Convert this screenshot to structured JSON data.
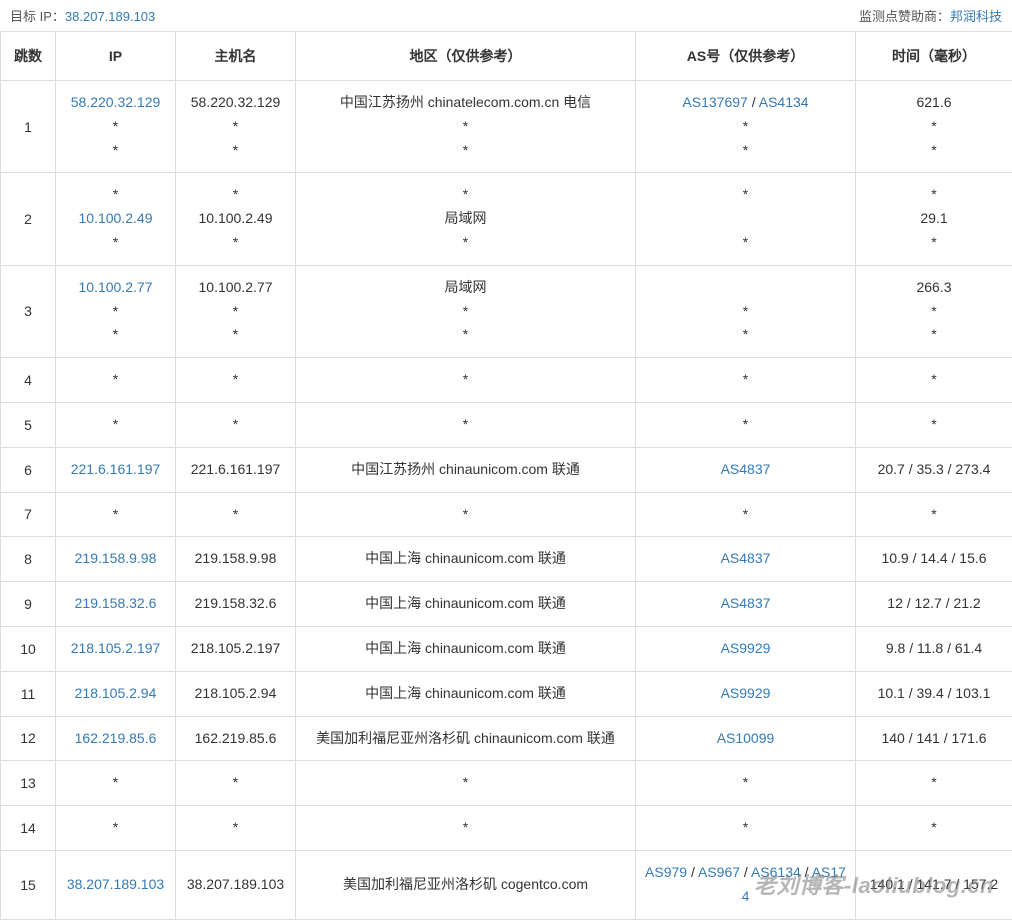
{
  "header": {
    "target_label": "目标 IP：",
    "target_ip": "38.207.189.103",
    "sponsor_label": "监测点赞助商：",
    "sponsor_name": "邦润科技"
  },
  "columns": {
    "hop": "跳数",
    "ip": "IP",
    "host": "主机名",
    "region": "地区（仅供参考）",
    "as": "AS号（仅供参考）",
    "time": "时间（毫秒）"
  },
  "rows": [
    {
      "hop": "1",
      "ip_lines": [
        {
          "text": "58.220.32.129",
          "link": true
        },
        {
          "text": "*"
        },
        {
          "text": "*"
        }
      ],
      "host_lines": [
        "58.220.32.129",
        "*",
        "*"
      ],
      "region_lines": [
        "中国江苏扬州 chinatelecom.com.cn 电信",
        "*",
        "*"
      ],
      "as_lines": [
        [
          {
            "text": "AS137697",
            "link": true
          },
          {
            "text": " / "
          },
          {
            "text": "AS4134",
            "link": true
          }
        ],
        [
          "*"
        ],
        [
          "*"
        ]
      ],
      "time_lines": [
        "621.6",
        "*",
        "*"
      ]
    },
    {
      "hop": "2",
      "ip_lines": [
        {
          "text": "*"
        },
        {
          "text": "10.100.2.49",
          "link": true
        },
        {
          "text": "*"
        }
      ],
      "host_lines": [
        "*",
        "10.100.2.49",
        "*"
      ],
      "region_lines": [
        "*",
        "局域网",
        "*"
      ],
      "as_lines": [
        [
          "*"
        ],
        [
          ""
        ],
        [
          "*"
        ]
      ],
      "time_lines": [
        "*",
        "29.1",
        "*"
      ]
    },
    {
      "hop": "3",
      "ip_lines": [
        {
          "text": "10.100.2.77",
          "link": true
        },
        {
          "text": "*"
        },
        {
          "text": "*"
        }
      ],
      "host_lines": [
        "10.100.2.77",
        "*",
        "*"
      ],
      "region_lines": [
        "局域网",
        "*",
        "*"
      ],
      "as_lines": [
        [
          ""
        ],
        [
          "*"
        ],
        [
          "*"
        ]
      ],
      "time_lines": [
        "266.3",
        "*",
        "*"
      ]
    },
    {
      "hop": "4",
      "ip_lines": [
        {
          "text": "*"
        }
      ],
      "host_lines": [
        "*"
      ],
      "region_lines": [
        "*"
      ],
      "as_lines": [
        [
          "*"
        ]
      ],
      "time_lines": [
        "*"
      ]
    },
    {
      "hop": "5",
      "ip_lines": [
        {
          "text": "*"
        }
      ],
      "host_lines": [
        "*"
      ],
      "region_lines": [
        "*"
      ],
      "as_lines": [
        [
          "*"
        ]
      ],
      "time_lines": [
        "*"
      ]
    },
    {
      "hop": "6",
      "ip_lines": [
        {
          "text": "221.6.161.197",
          "link": true
        }
      ],
      "host_lines": [
        "221.6.161.197"
      ],
      "region_lines": [
        "中国江苏扬州 chinaunicom.com 联通"
      ],
      "as_lines": [
        [
          {
            "text": "AS4837",
            "link": true
          }
        ]
      ],
      "time_lines": [
        "20.7 / 35.3 / 273.4"
      ]
    },
    {
      "hop": "7",
      "ip_lines": [
        {
          "text": "*"
        }
      ],
      "host_lines": [
        "*"
      ],
      "region_lines": [
        "*"
      ],
      "as_lines": [
        [
          "*"
        ]
      ],
      "time_lines": [
        "*"
      ]
    },
    {
      "hop": "8",
      "ip_lines": [
        {
          "text": "219.158.9.98",
          "link": true
        }
      ],
      "host_lines": [
        "219.158.9.98"
      ],
      "region_lines": [
        "中国上海 chinaunicom.com 联通"
      ],
      "as_lines": [
        [
          {
            "text": "AS4837",
            "link": true
          }
        ]
      ],
      "time_lines": [
        "10.9 / 14.4 / 15.6"
      ]
    },
    {
      "hop": "9",
      "ip_lines": [
        {
          "text": "219.158.32.6",
          "link": true
        }
      ],
      "host_lines": [
        "219.158.32.6"
      ],
      "region_lines": [
        "中国上海 chinaunicom.com 联通"
      ],
      "as_lines": [
        [
          {
            "text": "AS4837",
            "link": true
          }
        ]
      ],
      "time_lines": [
        "12 / 12.7 / 21.2"
      ]
    },
    {
      "hop": "10",
      "ip_lines": [
        {
          "text": "218.105.2.197",
          "link": true
        }
      ],
      "host_lines": [
        "218.105.2.197"
      ],
      "region_lines": [
        "中国上海 chinaunicom.com 联通"
      ],
      "as_lines": [
        [
          {
            "text": "AS9929",
            "link": true
          }
        ]
      ],
      "time_lines": [
        "9.8 / 11.8 / 61.4"
      ]
    },
    {
      "hop": "11",
      "ip_lines": [
        {
          "text": "218.105.2.94",
          "link": true
        }
      ],
      "host_lines": [
        "218.105.2.94"
      ],
      "region_lines": [
        "中国上海 chinaunicom.com 联通"
      ],
      "as_lines": [
        [
          {
            "text": "AS9929",
            "link": true
          }
        ]
      ],
      "time_lines": [
        "10.1 / 39.4 / 103.1"
      ]
    },
    {
      "hop": "12",
      "ip_lines": [
        {
          "text": "162.219.85.6",
          "link": true
        }
      ],
      "host_lines": [
        "162.219.85.6"
      ],
      "region_lines": [
        "美国加利福尼亚州洛杉矶 chinaunicom.com 联通"
      ],
      "as_lines": [
        [
          {
            "text": "AS10099",
            "link": true
          }
        ]
      ],
      "time_lines": [
        "140 / 141 / 171.6"
      ]
    },
    {
      "hop": "13",
      "ip_lines": [
        {
          "text": "*"
        }
      ],
      "host_lines": [
        "*"
      ],
      "region_lines": [
        "*"
      ],
      "as_lines": [
        [
          "*"
        ]
      ],
      "time_lines": [
        "*"
      ]
    },
    {
      "hop": "14",
      "ip_lines": [
        {
          "text": "*"
        }
      ],
      "host_lines": [
        "*"
      ],
      "region_lines": [
        "*"
      ],
      "as_lines": [
        [
          "*"
        ]
      ],
      "time_lines": [
        "*"
      ]
    },
    {
      "hop": "15",
      "ip_lines": [
        {
          "text": "38.207.189.103",
          "link": true
        }
      ],
      "host_lines": [
        "38.207.189.103"
      ],
      "region_lines": [
        "美国加利福尼亚州洛杉矶 cogentco.com"
      ],
      "as_lines": [
        [
          {
            "text": "AS979",
            "link": true
          },
          {
            "text": " / "
          },
          {
            "text": "AS967",
            "link": true
          },
          {
            "text": " / "
          },
          {
            "text": "AS6134",
            "link": true
          },
          {
            "text": " / "
          },
          {
            "text": "AS174",
            "link": true
          }
        ]
      ],
      "time_lines": [
        "140.1 / 141.7 / 157.2"
      ]
    }
  ],
  "watermark": "老刘博客-laoliublog.cn"
}
